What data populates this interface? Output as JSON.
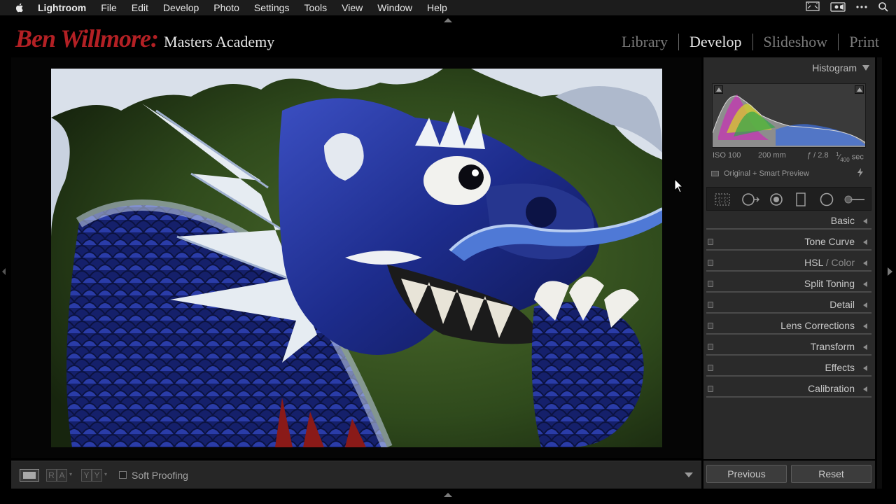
{
  "menubar": {
    "apple_icon": "apple-logo-icon",
    "items": [
      "Lightroom",
      "File",
      "Edit",
      "Develop",
      "Photo",
      "Settings",
      "Tools",
      "View",
      "Window",
      "Help"
    ],
    "tray_icons": [
      "airplay-display-icon",
      "screen-record-icon",
      "more-icon",
      "search-icon"
    ]
  },
  "identity": {
    "script": "Ben Willmore:",
    "name": "Masters Academy",
    "script_color": "#b32024"
  },
  "modules": [
    "Library",
    "Develop",
    "Slideshow",
    "Print"
  ],
  "active_module": "Develop",
  "toolbar": {
    "view_icon": "loupe-view-icon",
    "before_after_label": "RA",
    "swap_label": "YY",
    "soft_proofing_label": "Soft Proofing",
    "soft_proofing_checked": false
  },
  "right_panel": {
    "histogram_title": "Histogram",
    "exif": {
      "iso": "ISO 100",
      "focal": "200 mm",
      "aperture": "ƒ / 2.8",
      "shutter_num": "1",
      "shutter_den": "400",
      "shutter_unit": "sec"
    },
    "preview_status": "Original + Smart Preview",
    "tools": [
      "crop-overlay-icon",
      "spot-removal-icon",
      "red-eye-icon",
      "graduated-filter-icon",
      "radial-filter-icon",
      "adjustment-brush-icon"
    ],
    "sections": [
      {
        "name": "basic",
        "label": "Basic",
        "has_switch": false
      },
      {
        "name": "tone-curve",
        "label": "Tone Curve",
        "has_switch": true
      },
      {
        "name": "hsl-color",
        "label": "HSL",
        "label_suffix": "Color",
        "has_switch": true
      },
      {
        "name": "split-toning",
        "label": "Split Toning",
        "has_switch": true
      },
      {
        "name": "detail",
        "label": "Detail",
        "has_switch": true
      },
      {
        "name": "lens-corrections",
        "label": "Lens Corrections",
        "has_switch": true
      },
      {
        "name": "transform",
        "label": "Transform",
        "has_switch": true
      },
      {
        "name": "effects",
        "label": "Effects",
        "has_switch": true
      },
      {
        "name": "calibration",
        "label": "Calibration",
        "has_switch": true
      }
    ],
    "previous_label": "Previous",
    "reset_label": "Reset"
  },
  "photo": {
    "subject_icon": "blue-porcelain-dragon-photo",
    "background_color": "#3c5a24",
    "porcelain_blue": "#1c2f8f",
    "porcelain_white": "#e6ecf2"
  }
}
